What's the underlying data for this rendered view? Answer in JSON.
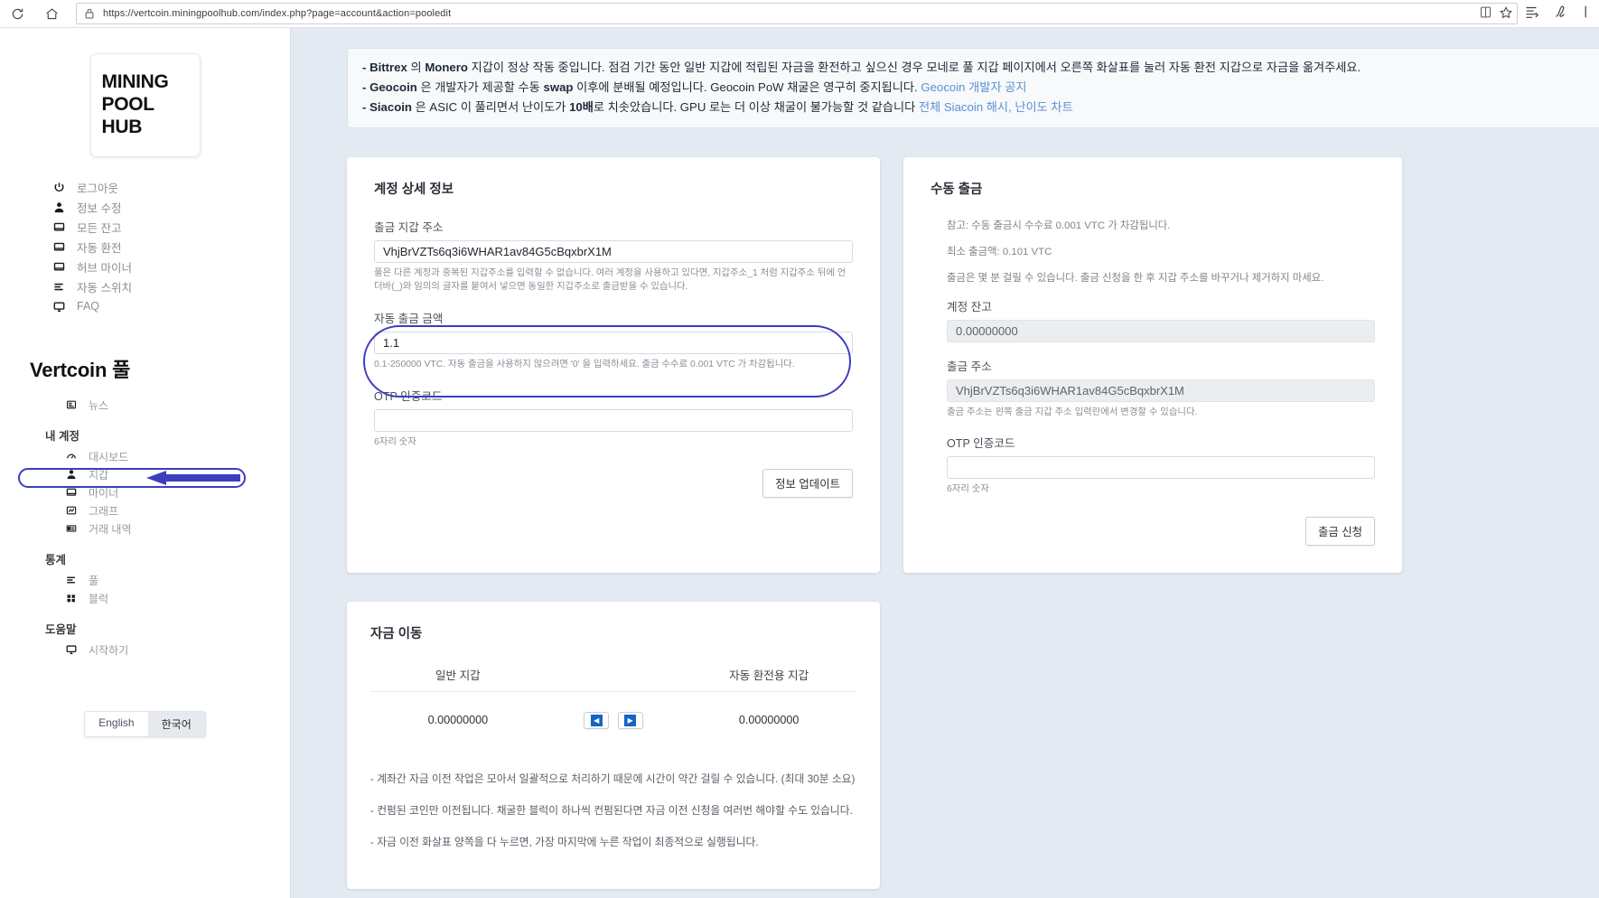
{
  "browser": {
    "url": "https://vertcoin.miningpoolhub.com/index.php?page=account&action=pooledit",
    "reload_icon": "reload-icon",
    "home_icon": "home-icon",
    "lock_icon": "lock-icon",
    "reading_view_icon": "reading-view-icon",
    "favorite_icon": "star-icon",
    "collections_icon": "collections-icon",
    "notes_icon": "notes-icon"
  },
  "sidebar": {
    "logo": [
      "MINING",
      "POOL",
      "HUB"
    ],
    "top_items": [
      {
        "label": "로그아웃",
        "icon": "power-icon"
      },
      {
        "label": "정보 수정",
        "icon": "user-icon"
      },
      {
        "label": "모든 잔고",
        "icon": "monitor-icon"
      },
      {
        "label": "자동 환전",
        "icon": "monitor-icon"
      },
      {
        "label": "허브 마이너",
        "icon": "monitor-icon"
      },
      {
        "label": "자동 스위치",
        "icon": "list-icon"
      },
      {
        "label": "FAQ",
        "icon": "display-icon"
      }
    ],
    "pool_title": "Vertcoin 풀",
    "news": {
      "label": "뉴스",
      "icon": "news-icon"
    },
    "sections": [
      {
        "heading": "내 계정",
        "items": [
          {
            "label": "대시보드",
            "icon": "gauge-icon"
          },
          {
            "label": "지갑",
            "icon": "user-icon"
          },
          {
            "label": "마이너",
            "icon": "monitor-icon"
          },
          {
            "label": "그래프",
            "icon": "chart-icon"
          },
          {
            "label": "거래 내역",
            "icon": "ledger-icon"
          }
        ]
      },
      {
        "heading": "통계",
        "items": [
          {
            "label": "풀",
            "icon": "list-icon"
          },
          {
            "label": "블럭",
            "icon": "grid-icon"
          }
        ]
      },
      {
        "heading": "도움말",
        "items": [
          {
            "label": "시작하기",
            "icon": "display-icon"
          }
        ]
      }
    ],
    "language": {
      "english": "English",
      "korean": "한국어",
      "active": "한국어"
    }
  },
  "notice": {
    "lines": [
      {
        "prefix": "- ",
        "bold1": "Bittrex",
        "mid1": " 의 ",
        "bold2": "Monero",
        "rest": " 지갑이 정상 작동 중입니다. 점검 기간 동안 일반 지갑에 적립된 자금을 환전하고 싶으신 경우 모네로 풀 지갑 페이지에서 오른쪽 화살표를 눌러 자동 환전 지갑으로 자금을 옮겨주세요.",
        "link": ""
      },
      {
        "prefix": "- ",
        "bold1": "Geocoin",
        "mid1": " 은 개발자가 제공할 수동 ",
        "bold2": "swap",
        "rest": " 이후에 분배될 예정입니다. Geocoin PoW 채굴은 영구히 중지됩니다. ",
        "link": "Geocoin 개발자 공지"
      },
      {
        "prefix": "- ",
        "bold1": "Siacoin",
        "mid1": " 은 ASIC 이 풀리면서 난이도가 ",
        "bold2": "10배",
        "rest": "로 치솟았습니다. GPU 로는 더 이상 채굴이 불가능할 것 같습니다 ",
        "link": "전체 Siacoin 해시, 난이도 차트"
      }
    ]
  },
  "account_card": {
    "title": "계정 상세 정보",
    "wallet": {
      "label": "출금 지갑 주소",
      "value": "VhjBrVZTs6q3i6WHAR1av84G5cBqxbrX1M",
      "help": "풀은 다른 계정과 중복된 지갑주소를 입력할 수 없습니다. 여러 계정을 사용하고 있다면, 지갑주소_1 처럼 지갑주소 뒤에 언더바(_)와 임의의 글자를 붙여서 넣으면 동일한 지갑주소로 출금받을 수 있습니다."
    },
    "auto_amount": {
      "label": "자동 출금 금액",
      "value": "1.1",
      "help": "0.1-250000 VTC. 자동 출금을 사용하지 않으려면 '0' 을 입력하세요. 출금 수수료 0.001 VTC 가 차감됩니다."
    },
    "otp": {
      "label": "OTP 인증코드",
      "value": "",
      "help": "6자리 숫자"
    },
    "submit_label": "정보 업데이트"
  },
  "withdraw_card": {
    "title": "수동 출금",
    "notes": [
      "참고: 수동 출금시 수수료 0.001 VTC 가 차감됩니다.",
      "최소 출금액: 0.101 VTC",
      "출금은 몇 분 걸릴 수 있습니다. 출금 신청을 한 후 지갑 주소를 바꾸거나 제거하지 마세요."
    ],
    "balance": {
      "label": "계정 잔고",
      "value": "0.00000000"
    },
    "address": {
      "label": "출금 주소",
      "value": "VhjBrVZTs6q3i6WHAR1av84G5cBqxbrX1M",
      "help": "출금 주소는 왼쪽 출금 지갑 주소 입력란에서 변경할 수 있습니다."
    },
    "otp": {
      "label": "OTP 인증코드",
      "value": "",
      "help": "6자리 숫자"
    },
    "submit_label": "출금 신청"
  },
  "transfer_card": {
    "title": "자금 이동",
    "col_left": "일반 지갑",
    "col_right": "자동 환전용 지갑",
    "left_value": "0.00000000",
    "right_value": "0.00000000",
    "left_arrow_icon": "arrow-left-icon",
    "right_arrow_icon": "arrow-right-icon",
    "notes": [
      "- 계좌간 자금 이전 작업은 모아서 일괄적으로 처리하기 때문에 시간이 약간 걸릴 수 있습니다. (최대 30분 소요)",
      "- 컨펌된 코인만 이전됩니다. 채굴한 블럭이 하나씩 컨펌된다면 자금 이전 신청을 여러번 해야할 수도 있습니다.",
      "- 자금 이전 화살표 양쪽을 다 누르면, 가장 마지막에 누른 작업이 최종적으로 실행됩니다."
    ]
  },
  "colors": {
    "accent_blue": "#3d3dbf",
    "link_blue": "#5b8fd6",
    "page_bg": "#e4eaf1"
  }
}
